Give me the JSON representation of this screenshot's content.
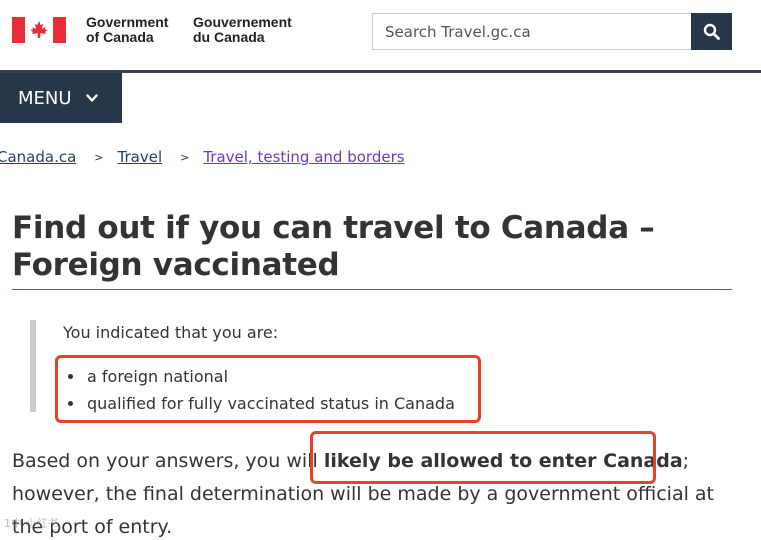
{
  "header": {
    "wordmark_en_line1": "Government",
    "wordmark_en_line2": "of Canada",
    "wordmark_fr_line1": "Gouvernement",
    "wordmark_fr_line2": "du Canada",
    "flag_icon": "canada-flag-icon",
    "search": {
      "placeholder": "Search Travel.gc.ca",
      "value": "",
      "button_icon": "search-icon"
    }
  },
  "menu": {
    "label": "MENU",
    "icon": "chevron-down-icon"
  },
  "breadcrumb": [
    {
      "label": "Canada.ca"
    },
    {
      "label": "Travel"
    },
    {
      "label": "Travel, testing and borders"
    }
  ],
  "page": {
    "title": "Find out if you can travel to Canada – Foreign vaccinated",
    "callout": {
      "lead": "You indicated that you are:",
      "items": [
        "a foreign national",
        "qualified for fully vaccinated status in Canada"
      ]
    },
    "result_before": "Based on your answers, you will ",
    "result_strong": "likely be allowed to enter Canada",
    "result_after": "; however, the final determination will be made by a government official at the port of entry."
  },
  "colors": {
    "nav": "#26374a",
    "title_rule": "#af3c43",
    "visited_link": "#7834bc",
    "annotation": "#e8402c"
  },
  "watermark": "1中 小红书"
}
